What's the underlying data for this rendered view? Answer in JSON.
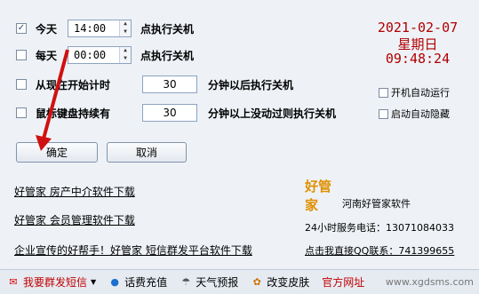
{
  "rows": [
    {
      "label": "今天",
      "time": "14:00",
      "suffix": "点执行关机",
      "checked": true
    },
    {
      "label": "每天",
      "time": "00:00",
      "suffix": "点执行关机",
      "checked": false
    }
  ],
  "timer": {
    "label": "从现在开始计时",
    "value": "30",
    "suffix": "分钟以后执行关机"
  },
  "idle": {
    "label": "鼠标键盘持续有",
    "value": "30",
    "suffix": "分钟以上没动过则执行关机"
  },
  "clock": {
    "date": "2021-02-07",
    "weekday": "星期日",
    "time": "09:48:24"
  },
  "options": {
    "autostart": "开机自动运行",
    "hide": "启动自动隐藏"
  },
  "buttons": {
    "ok": "确定",
    "cancel": "取消"
  },
  "links": [
    "好管家 房产中介软件下载",
    "好管家 会员管理软件下载",
    "企业宣传的好帮手！好管家 短信群发平台软件下载"
  ],
  "company": {
    "logo_text": "好管家",
    "name": "河南好管家软件",
    "service": "24小时服务电话：13071084033",
    "qq": "点击我直接QQ联系：741399655"
  },
  "bottom": {
    "sms": "我要群发短信",
    "recharge": "话费充值",
    "weather": "天气预报",
    "skin": "改变皮肤",
    "site": "官方网址"
  },
  "watermark": "www.xgdsms.com",
  "colors": {
    "clock": "#b00000",
    "arrow": "#d01010",
    "accent": "#c00000"
  }
}
